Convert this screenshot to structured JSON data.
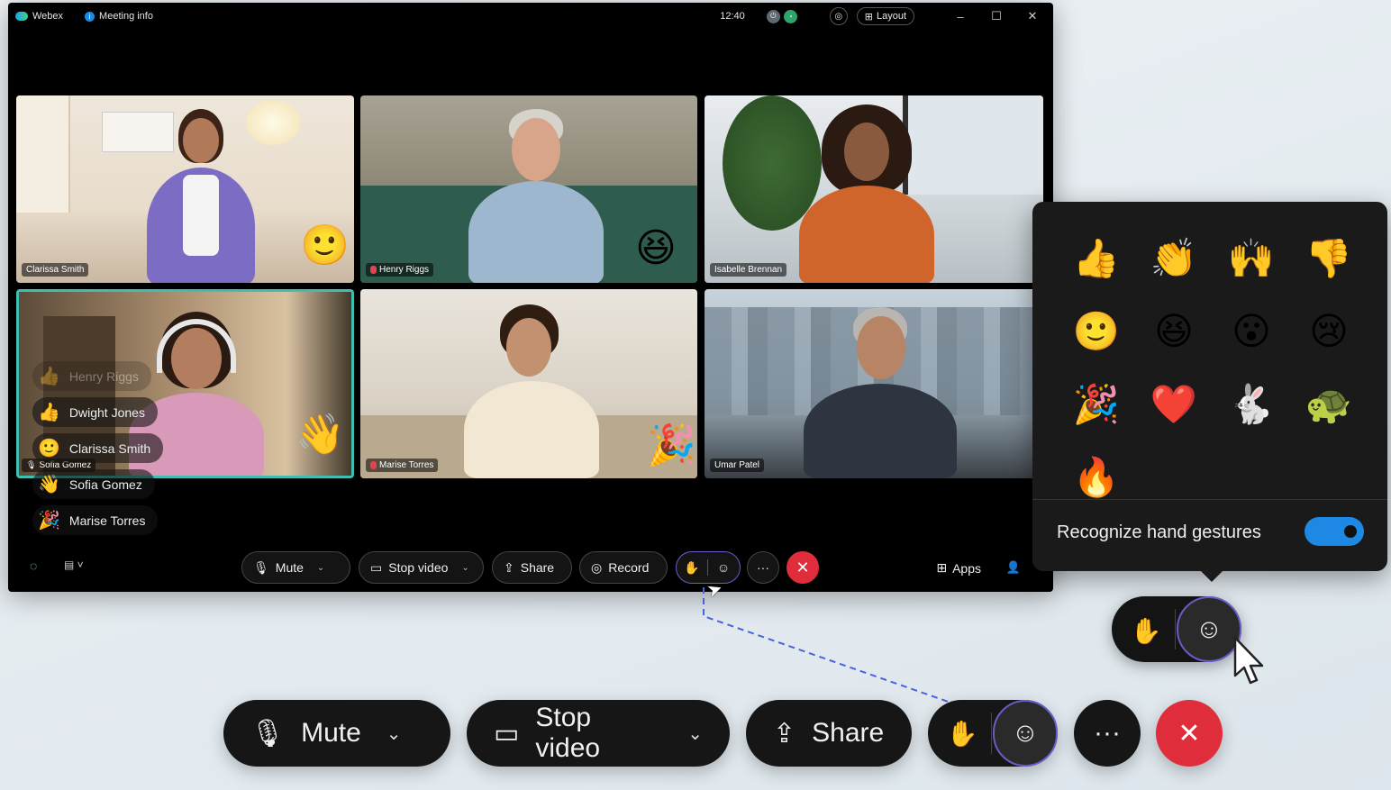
{
  "titlebar": {
    "app_name": "Webex",
    "meeting_info": "Meeting info",
    "time": "12:40",
    "layout_label": "Layout",
    "minimize": "–",
    "maximize": "☐",
    "close": "✕"
  },
  "participants": [
    {
      "name": "Clarissa Smith",
      "reaction": "🙂",
      "muted": false
    },
    {
      "name": "Henry Riggs",
      "reaction": "😆",
      "muted": true
    },
    {
      "name": "Isabelle Brennan",
      "reaction": "",
      "muted": false
    },
    {
      "name": "Sofia Gomez",
      "reaction": "👋",
      "muted": false,
      "active": true
    },
    {
      "name": "Marise Torres",
      "reaction": "🎉",
      "muted": true
    },
    {
      "name": "Umar Patel",
      "reaction": "",
      "muted": false
    }
  ],
  "reaction_feed": [
    {
      "emoji": "👍",
      "name": "Henry Riggs"
    },
    {
      "emoji": "👍",
      "name": "Dwight Jones"
    },
    {
      "emoji": "🙂",
      "name": "Clarissa Smith"
    },
    {
      "emoji": "👋",
      "name": "Sofia Gomez"
    },
    {
      "emoji": "🎉",
      "name": "Marise Torres"
    }
  ],
  "toolbar": {
    "mute": "Mute",
    "stop_video": "Stop video",
    "share": "Share",
    "record": "Record",
    "more": "···",
    "end": "✕",
    "apps": "Apps"
  },
  "reactions_popup": {
    "emojis": [
      "👍",
      "👏",
      "🙌",
      "👎",
      "🙂",
      "😆",
      "😮",
      "😢",
      "🎉",
      "❤️",
      "🐇",
      "🐢",
      "🔥"
    ],
    "gesture_label": "Recognize hand gestures",
    "gesture_enabled": true
  },
  "enlarged_toolbar": {
    "mute": "Mute",
    "stop_video": "Stop video",
    "share": "Share",
    "more": "···",
    "end": "✕"
  },
  "colors": {
    "accent_teal": "#3fbfb0",
    "end_red": "#e02d3c",
    "toggle_blue": "#1e88e5",
    "reaction_outline": "#6a5cc7"
  }
}
